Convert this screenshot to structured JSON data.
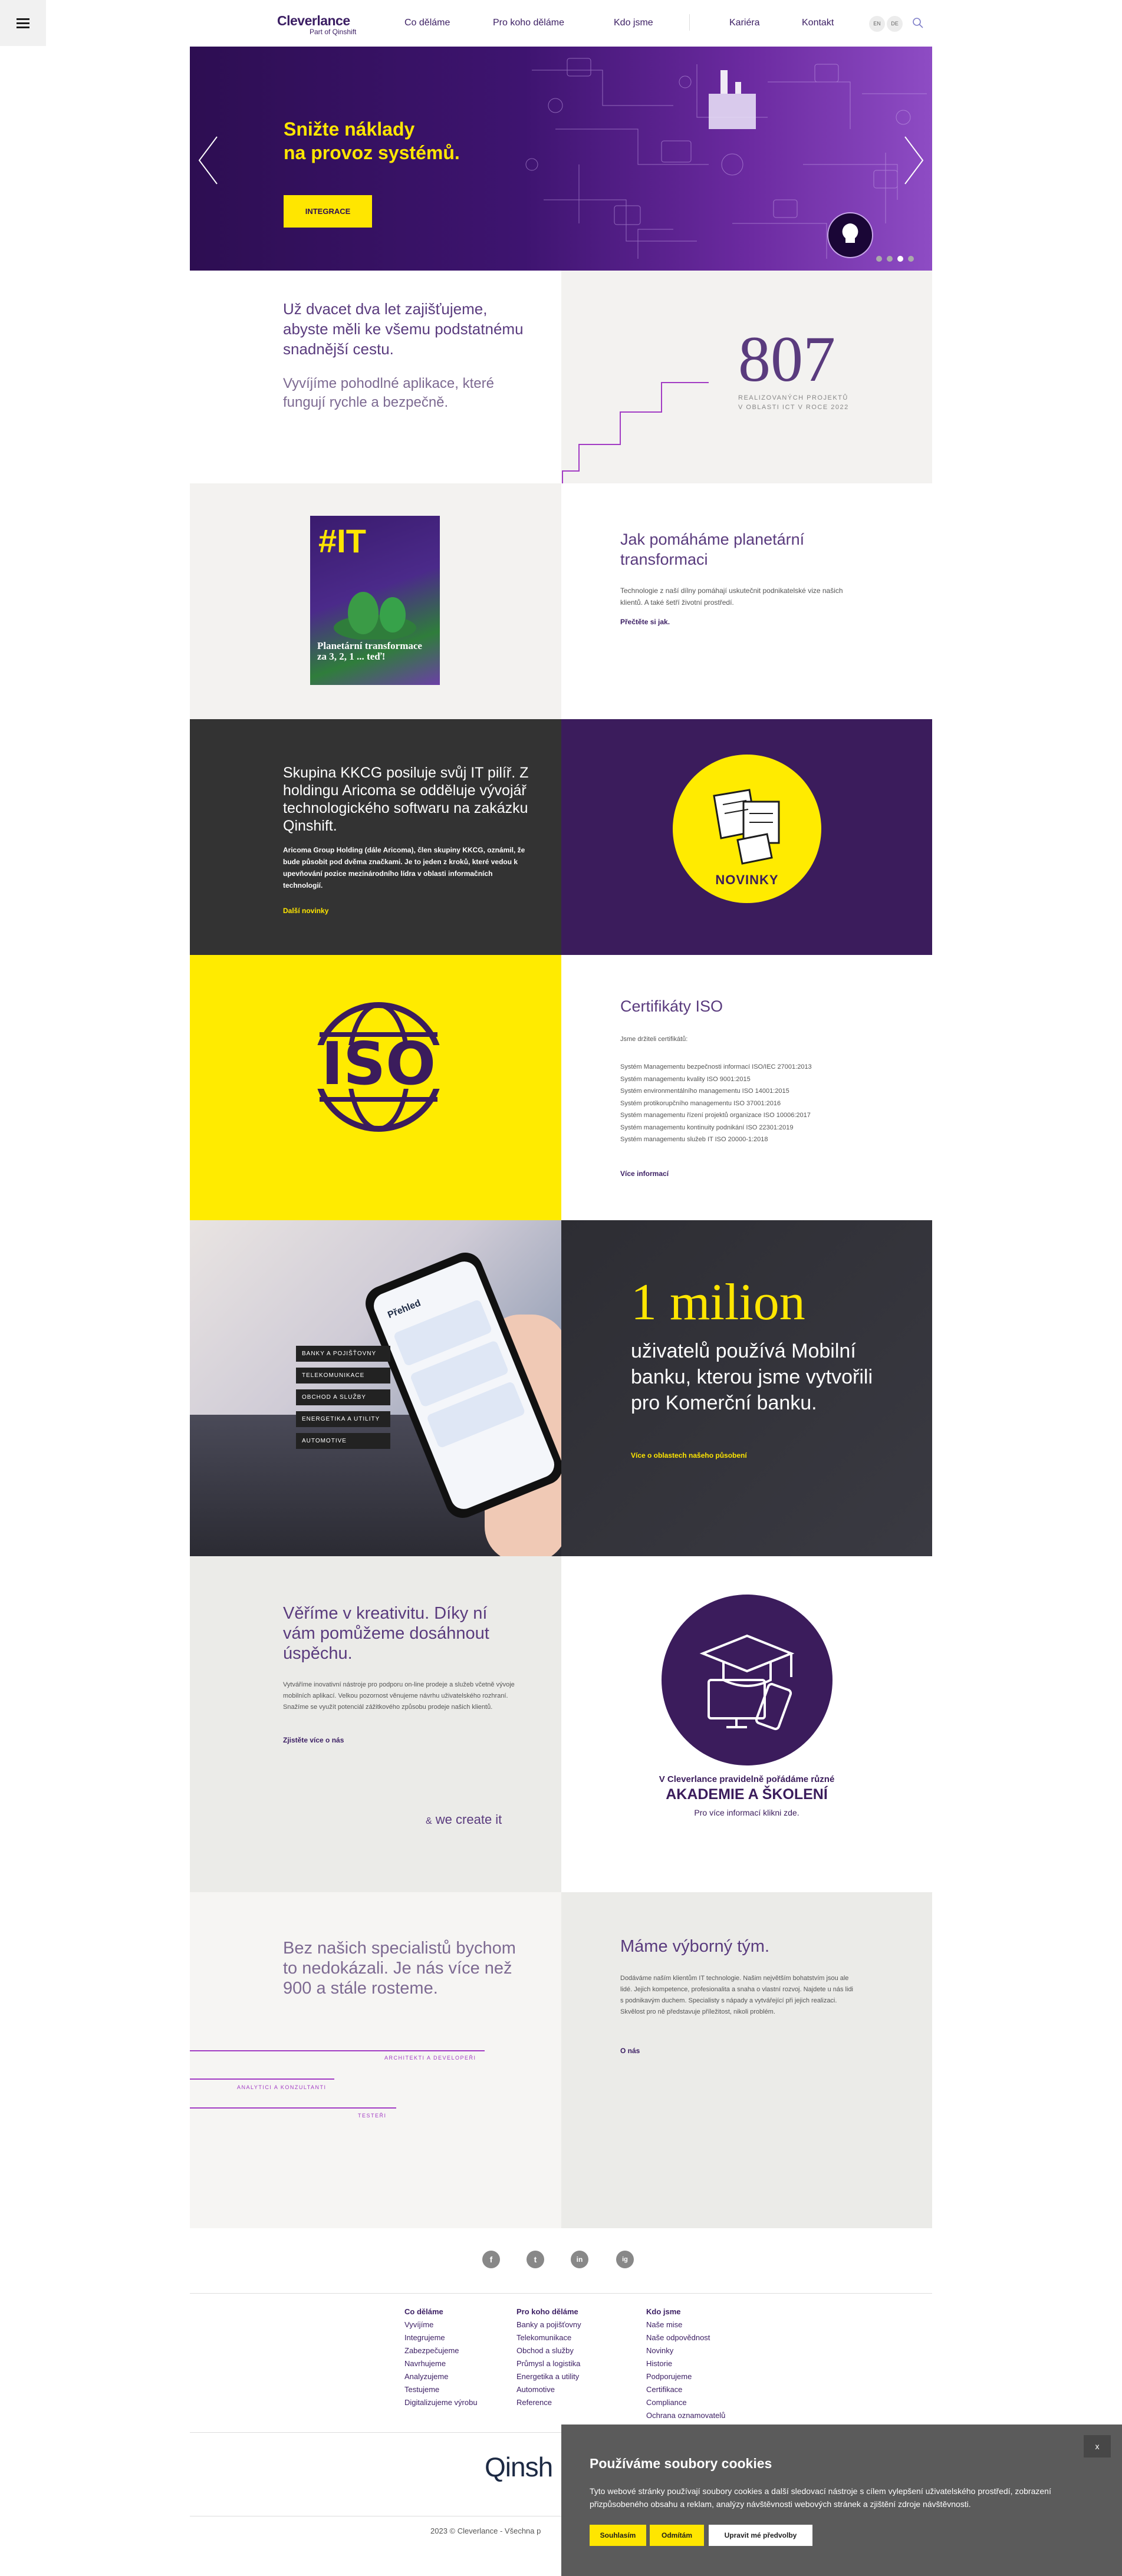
{
  "header": {
    "logo": "Cleverlance",
    "logo_sub": "Part of Qinshift",
    "nav": [
      "Co děláme",
      "Pro koho děláme",
      "Kdo jsme",
      "Kariéra",
      "Kontakt"
    ],
    "lang": [
      "EN",
      "DE"
    ]
  },
  "hero": {
    "title_line1": "Snižte náklady",
    "title_line2": "na provoz systémů.",
    "button": "INTEGRACE",
    "slides": 4,
    "active_slide": 3
  },
  "intro": {
    "lead": "Už dvacet dva let zajišťujeme, abyste měli ke všemu podstatnému snadnější cestu.",
    "sub": "Vyvíjíme pohodlné aplikace, které fungují rychle a bezpečně.",
    "stat_value": "807",
    "stat_label_1": "REALIZOVANÝCH PROJEKTŮ",
    "stat_label_2": "V OBLASTI ICT V ROCE 2022"
  },
  "magazine": {
    "cover_title": "#IT",
    "cover_text": "Planetární transformace za 3, 2, 1 ... teď!",
    "title": "Jak pomáháme planetární transformaci",
    "text": "Technologie z naší dílny pomáhají uskutečnit podnikatelské vize našich klientů. A také šetří životní prostředí.",
    "link": "Přečtěte si jak."
  },
  "news": {
    "title": "Skupina KKCG posiluje svůj IT pilíř. Z holdingu Aricoma se odděluje vývojář technologického softwaru na zakázku Qinshift.",
    "text": "Aricoma Group Holding (dále Aricoma), člen skupiny KKCG, oznámil, že bude působit pod dvěma značkami. Je to jeden z kroků, které vedou k upevňování pozice mezinárodního lídra v oblasti informačních technologií.",
    "link": "Další novinky",
    "badge": "NOVINKY"
  },
  "iso": {
    "logo": "ISO",
    "title": "Certifikáty ISO",
    "intro": "Jsme držiteli certifikátů:",
    "items": [
      "Systém Managementu bezpečnosti informací ISO/IEC 27001:2013",
      "Systém managementu kvality ISO 9001:2015",
      "Systém environmentálního managementu ISO 14001:2015",
      "Systém protikorupčního managementu ISO 37001:2016",
      "Systém managementu řízení projektů organizace ISO 10006:2017",
      "Systém managementu kontinuity podnikání ISO 22301:2019",
      "Systém managementu služeb IT ISO 20000-1:2018"
    ],
    "link": "Více informací"
  },
  "mobile": {
    "tags": [
      "BANKY A POJIŠŤOVNY",
      "TELEKOMUNIKACE",
      "OBCHOD A SLUŽBY",
      "ENERGETIKA A UTILITY",
      "AUTOMOTIVE"
    ],
    "phone_header": "Přehled",
    "big": "1 milion",
    "text": "uživatelů používá Mobilní banku, kterou jsme vytvořili pro Komerční banku.",
    "link": "Více o oblastech našeho působení"
  },
  "creativity": {
    "title": "Věříme v kreativitu. Díky ní vám pomůžeme dosáhnout úspěchu.",
    "text": "Vytváříme inovativní nástroje pro podporu on-line prodeje a služeb včetně vývoje mobilních aplikací. Velkou pozornost věnujeme návrhu uživatelského rozhraní. Snažíme se využít potenciál zážitkového způsobu prodeje našich klientů.",
    "link": "Zjistěte více o nás",
    "tagline": "we create it",
    "academy_line": "V Cleverlance pravidelně pořádáme různé",
    "academy_title": "AKADEMIE A ŠKOLENÍ",
    "academy_sub": "Pro více informací klikni zde."
  },
  "team": {
    "title": "Bez našich specialistů bychom to nedokázali. Je nás více než 900 a stále rosteme.",
    "roles": [
      "ARCHITEKTI A DEVELOPEŘI",
      "ANALYTICI A KONZULTANTI",
      "TESTEŘI"
    ],
    "right_title": "Máme výborný tým.",
    "right_text": "Dodáváme naším klientům IT technologie. Našim největším bohatstvím jsou ale lidé. Jejich kompetence, profesionalita a snaha o vlastní rozvoj. Najdete u nás lidi s podnikavým duchem. Specialisty s nápady a vytvářející při jejich realizaci. Skvělost pro ně představuje příležitost, nikoli problém.",
    "right_link": "O nás"
  },
  "footer": {
    "social": [
      "f",
      "t",
      "in",
      "ig"
    ],
    "col1_title": "Co děláme",
    "col1": [
      "Vyvíjíme",
      "Integrujeme",
      "Zabezpečujeme",
      "Navrhujeme",
      "Analyzujeme",
      "Testujeme",
      "Digitalizujeme výrobu"
    ],
    "col2_title": "Pro koho děláme",
    "col2": [
      "Banky a pojišťovny",
      "Telekomunikace",
      "Obchod a služby",
      "Průmysl a logistika",
      "Energetika a utility",
      "Automotive",
      "Reference"
    ],
    "col3_title": "Kdo jsme",
    "col3": [
      "Naše mise",
      "Naše odpovědnost",
      "Novinky",
      "Historie",
      "Podporujeme",
      "Certifikace",
      "Compliance",
      "Ochrana oznamovatelů"
    ],
    "brand": "Qinsh",
    "copyright": "2023 © Cleverlance - Všechna p"
  },
  "cookies": {
    "close": "x",
    "title": "Používáme soubory cookies",
    "text": "Tyto webové stránky používají soubory cookies a další sledovací nástroje s cílem vylepšení uživatelského prostředí, zobrazení přizpůsobeného obsahu a reklam, analýzy návštěvnosti webových stránek a zjištění zdroje návštěvnosti.",
    "btn_accept": "Souhlasím",
    "btn_reject": "Odmítám",
    "btn_settings": "Upravit mé předvolby"
  }
}
